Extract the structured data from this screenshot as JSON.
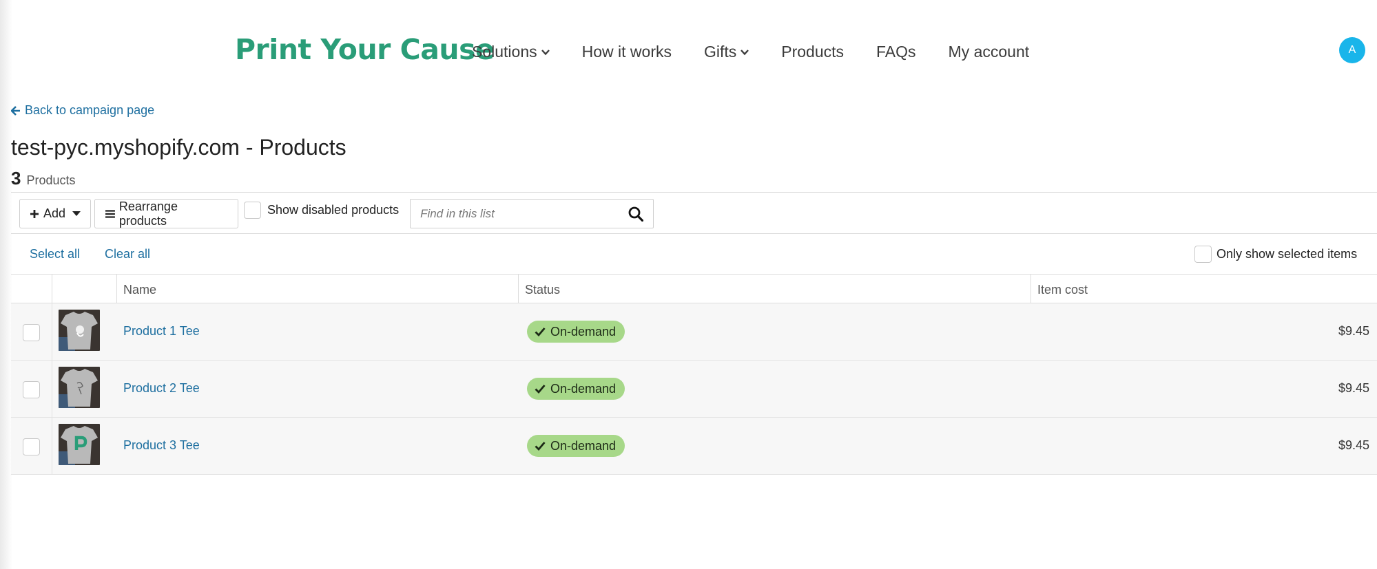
{
  "header": {
    "logo": "Print Your Cause",
    "nav": [
      {
        "label": "Solutions",
        "has_dropdown": true
      },
      {
        "label": "How it works",
        "has_dropdown": false
      },
      {
        "label": "Gifts",
        "has_dropdown": true
      },
      {
        "label": "Products",
        "has_dropdown": false
      },
      {
        "label": "FAQs",
        "has_dropdown": false
      },
      {
        "label": "My account",
        "has_dropdown": false
      }
    ],
    "avatar_initial": "A",
    "avatar_color": "#19b5ea"
  },
  "back_link": "Back to campaign page",
  "page_title": "test-pyc.myshopify.com - Products",
  "count": {
    "number": "3",
    "label": "Products"
  },
  "toolbar": {
    "add_label": "Add",
    "rearrange_label": "Rearrange products",
    "show_disabled_label": "Show disabled products",
    "search_placeholder": "Find in this list"
  },
  "selection": {
    "select_all": "Select all",
    "clear_all": "Clear all",
    "only_selected": "Only show selected items"
  },
  "table": {
    "columns": [
      "Name",
      "Status",
      "Item cost"
    ],
    "rows": [
      {
        "name": "Product 1 Tee",
        "status": "On-demand",
        "cost": "$9.45",
        "thumb_icon": "tee-shirt-graphic-icon"
      },
      {
        "name": "Product 2 Tee",
        "status": "On-demand",
        "cost": "$9.45",
        "thumb_icon": "tee-shirt-sketch-icon"
      },
      {
        "name": "Product 3 Tee",
        "status": "On-demand",
        "cost": "$9.45",
        "thumb_icon": "tee-shirt-letter-p-icon"
      }
    ]
  },
  "colors": {
    "brand_green": "#2a9d78",
    "link_blue": "#1e6fa0",
    "status_green": "#a7d889"
  }
}
